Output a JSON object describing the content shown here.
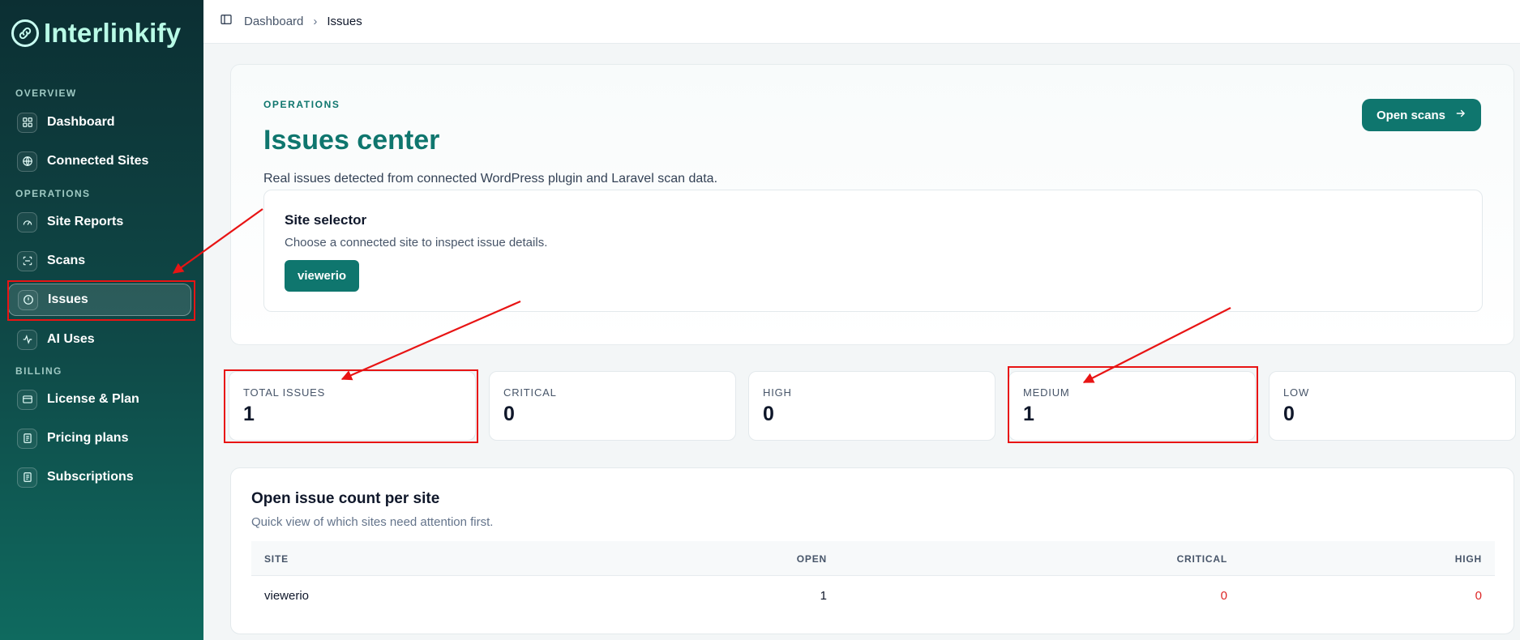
{
  "brand": {
    "name": "Interlinkify"
  },
  "sidebar": {
    "sections": [
      {
        "label": "OVERVIEW"
      },
      {
        "label": "OPERATIONS"
      },
      {
        "label": "BILLING"
      }
    ],
    "items": [
      {
        "label": "Dashboard",
        "icon": "grid-icon"
      },
      {
        "label": "Connected Sites",
        "icon": "globe-icon"
      },
      {
        "label": "Site Reports",
        "icon": "gauge-icon"
      },
      {
        "label": "Scans",
        "icon": "scan-icon"
      },
      {
        "label": "Issues",
        "icon": "alert-circle-icon",
        "active": true
      },
      {
        "label": "AI Uses",
        "icon": "activity-icon"
      },
      {
        "label": "License & Plan",
        "icon": "card-icon"
      },
      {
        "label": "Pricing plans",
        "icon": "document-icon"
      },
      {
        "label": "Subscriptions",
        "icon": "document-icon"
      }
    ]
  },
  "topbar": {
    "breadcrumb": [
      "Dashboard",
      "Issues"
    ],
    "separator": "›"
  },
  "hero": {
    "eyebrow": "OPERATIONS",
    "title": "Issues center",
    "description": "Real issues detected from connected WordPress plugin and Laravel scan data.",
    "open_scans_label": "Open scans"
  },
  "site_selector": {
    "title": "Site selector",
    "description": "Choose a connected site to inspect issue details.",
    "site_button": "viewerio"
  },
  "stats": [
    {
      "label": "TOTAL ISSUES",
      "value": "1"
    },
    {
      "label": "CRITICAL",
      "value": "0"
    },
    {
      "label": "HIGH",
      "value": "0"
    },
    {
      "label": "MEDIUM",
      "value": "1"
    },
    {
      "label": "LOW",
      "value": "0"
    }
  ],
  "site_table": {
    "title": "Open issue count per site",
    "description": "Quick view of which sites need attention first.",
    "columns": [
      "SITE",
      "OPEN",
      "CRITICAL",
      "HIGH"
    ],
    "rows": [
      {
        "site": "viewerio",
        "open": "1",
        "critical": "0",
        "high": "0"
      }
    ]
  },
  "colors": {
    "accent": "#0f766e",
    "annotation": "#e81414",
    "danger": "#dc2626"
  }
}
